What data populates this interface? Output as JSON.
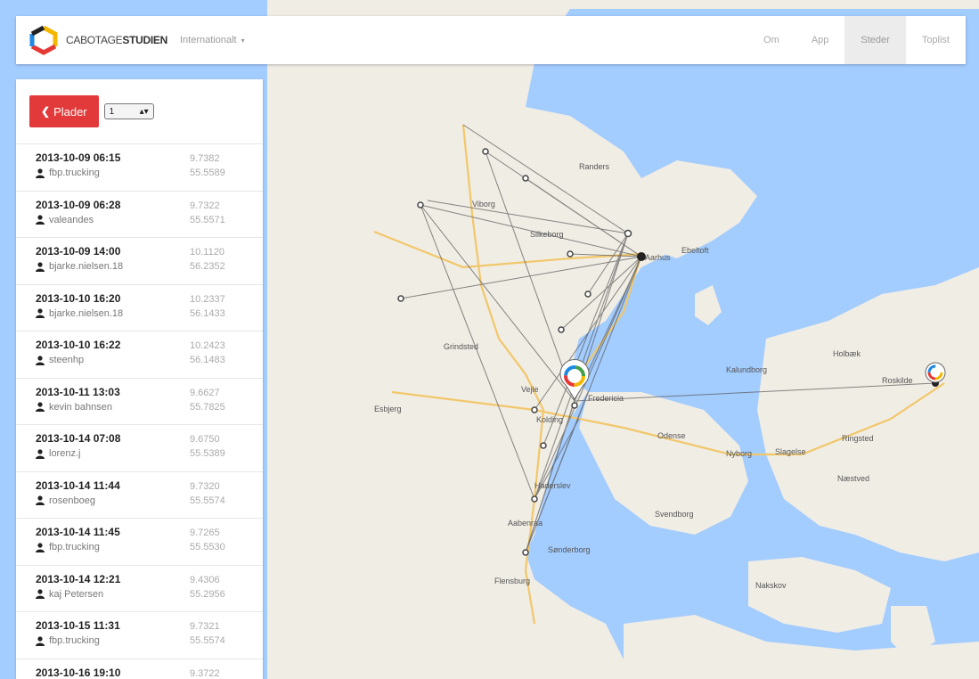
{
  "header": {
    "brand_light": "CABOTAGE",
    "brand_bold": "STUDIEN",
    "region": "Internationalt",
    "region_caret": "▾",
    "nav": [
      {
        "label": "Om",
        "active": false
      },
      {
        "label": "App",
        "active": false
      },
      {
        "label": "Steder",
        "active": true
      },
      {
        "label": "Toplist",
        "active": false
      }
    ]
  },
  "panel": {
    "back_label": "Plader",
    "back_icon": "chevron-left-icon",
    "select_value": "1",
    "entries": [
      {
        "date": "2013-10-09 06:15",
        "user": "fbp.trucking",
        "lon": "9.7382",
        "lat": "55.5589"
      },
      {
        "date": "2013-10-09 06:28",
        "user": "valeandes",
        "lon": "9.7322",
        "lat": "55.5571"
      },
      {
        "date": "2013-10-09 14:00",
        "user": "bjarke.nielsen.18",
        "lon": "10.1120",
        "lat": "56.2352"
      },
      {
        "date": "2013-10-10 16:20",
        "user": "bjarke.nielsen.18",
        "lon": "10.2337",
        "lat": "56.1433"
      },
      {
        "date": "2013-10-10 16:22",
        "user": "steenhp",
        "lon": "10.2423",
        "lat": "56.1483"
      },
      {
        "date": "2013-10-11 13:03",
        "user": "kevin bahnsen",
        "lon": "9.6627",
        "lat": "55.7825"
      },
      {
        "date": "2013-10-14 07:08",
        "user": "lorenz.j",
        "lon": "9.6750",
        "lat": "55.5389"
      },
      {
        "date": "2013-10-14 11:44",
        "user": "rosenboeg",
        "lon": "9.7320",
        "lat": "55.5574"
      },
      {
        "date": "2013-10-14 11:45",
        "user": "fbp.trucking",
        "lon": "9.7265",
        "lat": "55.5530"
      },
      {
        "date": "2013-10-14 12:21",
        "user": "kaj Petersen",
        "lon": "9.4306",
        "lat": "55.2956"
      },
      {
        "date": "2013-10-15 11:31",
        "user": "fbp.trucking",
        "lon": "9.7321",
        "lat": "55.5574"
      },
      {
        "date": "2013-10-16 19:10",
        "user": "",
        "lon": "9.3722",
        "lat": ""
      }
    ]
  },
  "map": {
    "water_color": "#a3ccff",
    "land_color": "#f0ede5",
    "labels": {
      "aarhus": "Aarhus",
      "vejle": "Vejle",
      "odense": "Odense",
      "randers": "Randers",
      "silkeborg": "Silkeborg",
      "kalundborg": "Kalundborg",
      "roskilde": "Roskilde",
      "naestved": "Næstved",
      "svendborg": "Svendborg",
      "haderslev": "Haderslev",
      "sonderborg": "Sønderborg",
      "ebeltoft": "Ebeltoft",
      "viborg": "Viborg",
      "grindsted": "Grindsted",
      "esbjerg": "Esbjerg",
      "kolding": "Kolding",
      "fredericia": "Fredericia",
      "aabenraa": "Aabenraa",
      "flensburg": "Flensburg",
      "nyborg": "Nyborg",
      "ringsted": "Ringsted",
      "slagelse": "Slagelse",
      "nakskov": "Nakskov",
      "holbaek": "Holbæk"
    }
  }
}
